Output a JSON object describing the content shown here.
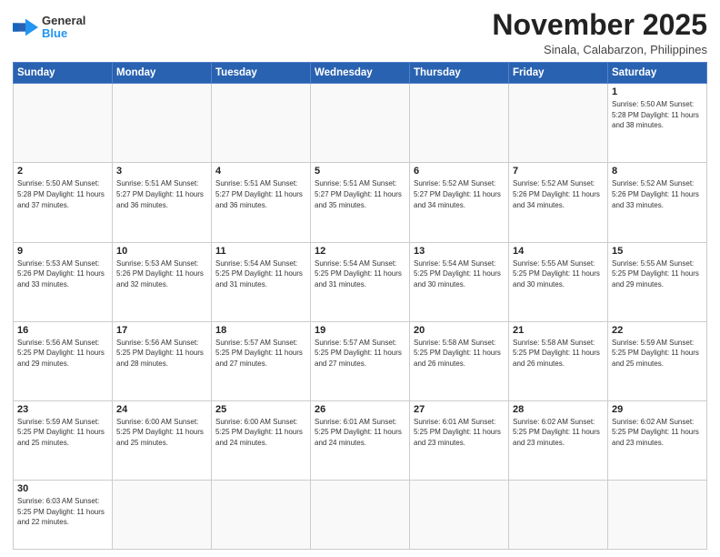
{
  "header": {
    "logo_general": "General",
    "logo_blue": "Blue",
    "month_title": "November 2025",
    "location": "Sinala, Calabarzon, Philippines"
  },
  "weekdays": [
    "Sunday",
    "Monday",
    "Tuesday",
    "Wednesday",
    "Thursday",
    "Friday",
    "Saturday"
  ],
  "weeks": [
    [
      {
        "day": "",
        "info": ""
      },
      {
        "day": "",
        "info": ""
      },
      {
        "day": "",
        "info": ""
      },
      {
        "day": "",
        "info": ""
      },
      {
        "day": "",
        "info": ""
      },
      {
        "day": "",
        "info": ""
      },
      {
        "day": "1",
        "info": "Sunrise: 5:50 AM\nSunset: 5:28 PM\nDaylight: 11 hours\nand 38 minutes."
      }
    ],
    [
      {
        "day": "2",
        "info": "Sunrise: 5:50 AM\nSunset: 5:28 PM\nDaylight: 11 hours\nand 37 minutes."
      },
      {
        "day": "3",
        "info": "Sunrise: 5:51 AM\nSunset: 5:27 PM\nDaylight: 11 hours\nand 36 minutes."
      },
      {
        "day": "4",
        "info": "Sunrise: 5:51 AM\nSunset: 5:27 PM\nDaylight: 11 hours\nand 36 minutes."
      },
      {
        "day": "5",
        "info": "Sunrise: 5:51 AM\nSunset: 5:27 PM\nDaylight: 11 hours\nand 35 minutes."
      },
      {
        "day": "6",
        "info": "Sunrise: 5:52 AM\nSunset: 5:27 PM\nDaylight: 11 hours\nand 34 minutes."
      },
      {
        "day": "7",
        "info": "Sunrise: 5:52 AM\nSunset: 5:26 PM\nDaylight: 11 hours\nand 34 minutes."
      },
      {
        "day": "8",
        "info": "Sunrise: 5:52 AM\nSunset: 5:26 PM\nDaylight: 11 hours\nand 33 minutes."
      }
    ],
    [
      {
        "day": "9",
        "info": "Sunrise: 5:53 AM\nSunset: 5:26 PM\nDaylight: 11 hours\nand 33 minutes."
      },
      {
        "day": "10",
        "info": "Sunrise: 5:53 AM\nSunset: 5:26 PM\nDaylight: 11 hours\nand 32 minutes."
      },
      {
        "day": "11",
        "info": "Sunrise: 5:54 AM\nSunset: 5:25 PM\nDaylight: 11 hours\nand 31 minutes."
      },
      {
        "day": "12",
        "info": "Sunrise: 5:54 AM\nSunset: 5:25 PM\nDaylight: 11 hours\nand 31 minutes."
      },
      {
        "day": "13",
        "info": "Sunrise: 5:54 AM\nSunset: 5:25 PM\nDaylight: 11 hours\nand 30 minutes."
      },
      {
        "day": "14",
        "info": "Sunrise: 5:55 AM\nSunset: 5:25 PM\nDaylight: 11 hours\nand 30 minutes."
      },
      {
        "day": "15",
        "info": "Sunrise: 5:55 AM\nSunset: 5:25 PM\nDaylight: 11 hours\nand 29 minutes."
      }
    ],
    [
      {
        "day": "16",
        "info": "Sunrise: 5:56 AM\nSunset: 5:25 PM\nDaylight: 11 hours\nand 29 minutes."
      },
      {
        "day": "17",
        "info": "Sunrise: 5:56 AM\nSunset: 5:25 PM\nDaylight: 11 hours\nand 28 minutes."
      },
      {
        "day": "18",
        "info": "Sunrise: 5:57 AM\nSunset: 5:25 PM\nDaylight: 11 hours\nand 27 minutes."
      },
      {
        "day": "19",
        "info": "Sunrise: 5:57 AM\nSunset: 5:25 PM\nDaylight: 11 hours\nand 27 minutes."
      },
      {
        "day": "20",
        "info": "Sunrise: 5:58 AM\nSunset: 5:25 PM\nDaylight: 11 hours\nand 26 minutes."
      },
      {
        "day": "21",
        "info": "Sunrise: 5:58 AM\nSunset: 5:25 PM\nDaylight: 11 hours\nand 26 minutes."
      },
      {
        "day": "22",
        "info": "Sunrise: 5:59 AM\nSunset: 5:25 PM\nDaylight: 11 hours\nand 25 minutes."
      }
    ],
    [
      {
        "day": "23",
        "info": "Sunrise: 5:59 AM\nSunset: 5:25 PM\nDaylight: 11 hours\nand 25 minutes."
      },
      {
        "day": "24",
        "info": "Sunrise: 6:00 AM\nSunset: 5:25 PM\nDaylight: 11 hours\nand 25 minutes."
      },
      {
        "day": "25",
        "info": "Sunrise: 6:00 AM\nSunset: 5:25 PM\nDaylight: 11 hours\nand 24 minutes."
      },
      {
        "day": "26",
        "info": "Sunrise: 6:01 AM\nSunset: 5:25 PM\nDaylight: 11 hours\nand 24 minutes."
      },
      {
        "day": "27",
        "info": "Sunrise: 6:01 AM\nSunset: 5:25 PM\nDaylight: 11 hours\nand 23 minutes."
      },
      {
        "day": "28",
        "info": "Sunrise: 6:02 AM\nSunset: 5:25 PM\nDaylight: 11 hours\nand 23 minutes."
      },
      {
        "day": "29",
        "info": "Sunrise: 6:02 AM\nSunset: 5:25 PM\nDaylight: 11 hours\nand 23 minutes."
      }
    ],
    [
      {
        "day": "30",
        "info": "Sunrise: 6:03 AM\nSunset: 5:25 PM\nDaylight: 11 hours\nand 22 minutes."
      },
      {
        "day": "",
        "info": ""
      },
      {
        "day": "",
        "info": ""
      },
      {
        "day": "",
        "info": ""
      },
      {
        "day": "",
        "info": ""
      },
      {
        "day": "",
        "info": ""
      },
      {
        "day": "",
        "info": ""
      }
    ]
  ]
}
